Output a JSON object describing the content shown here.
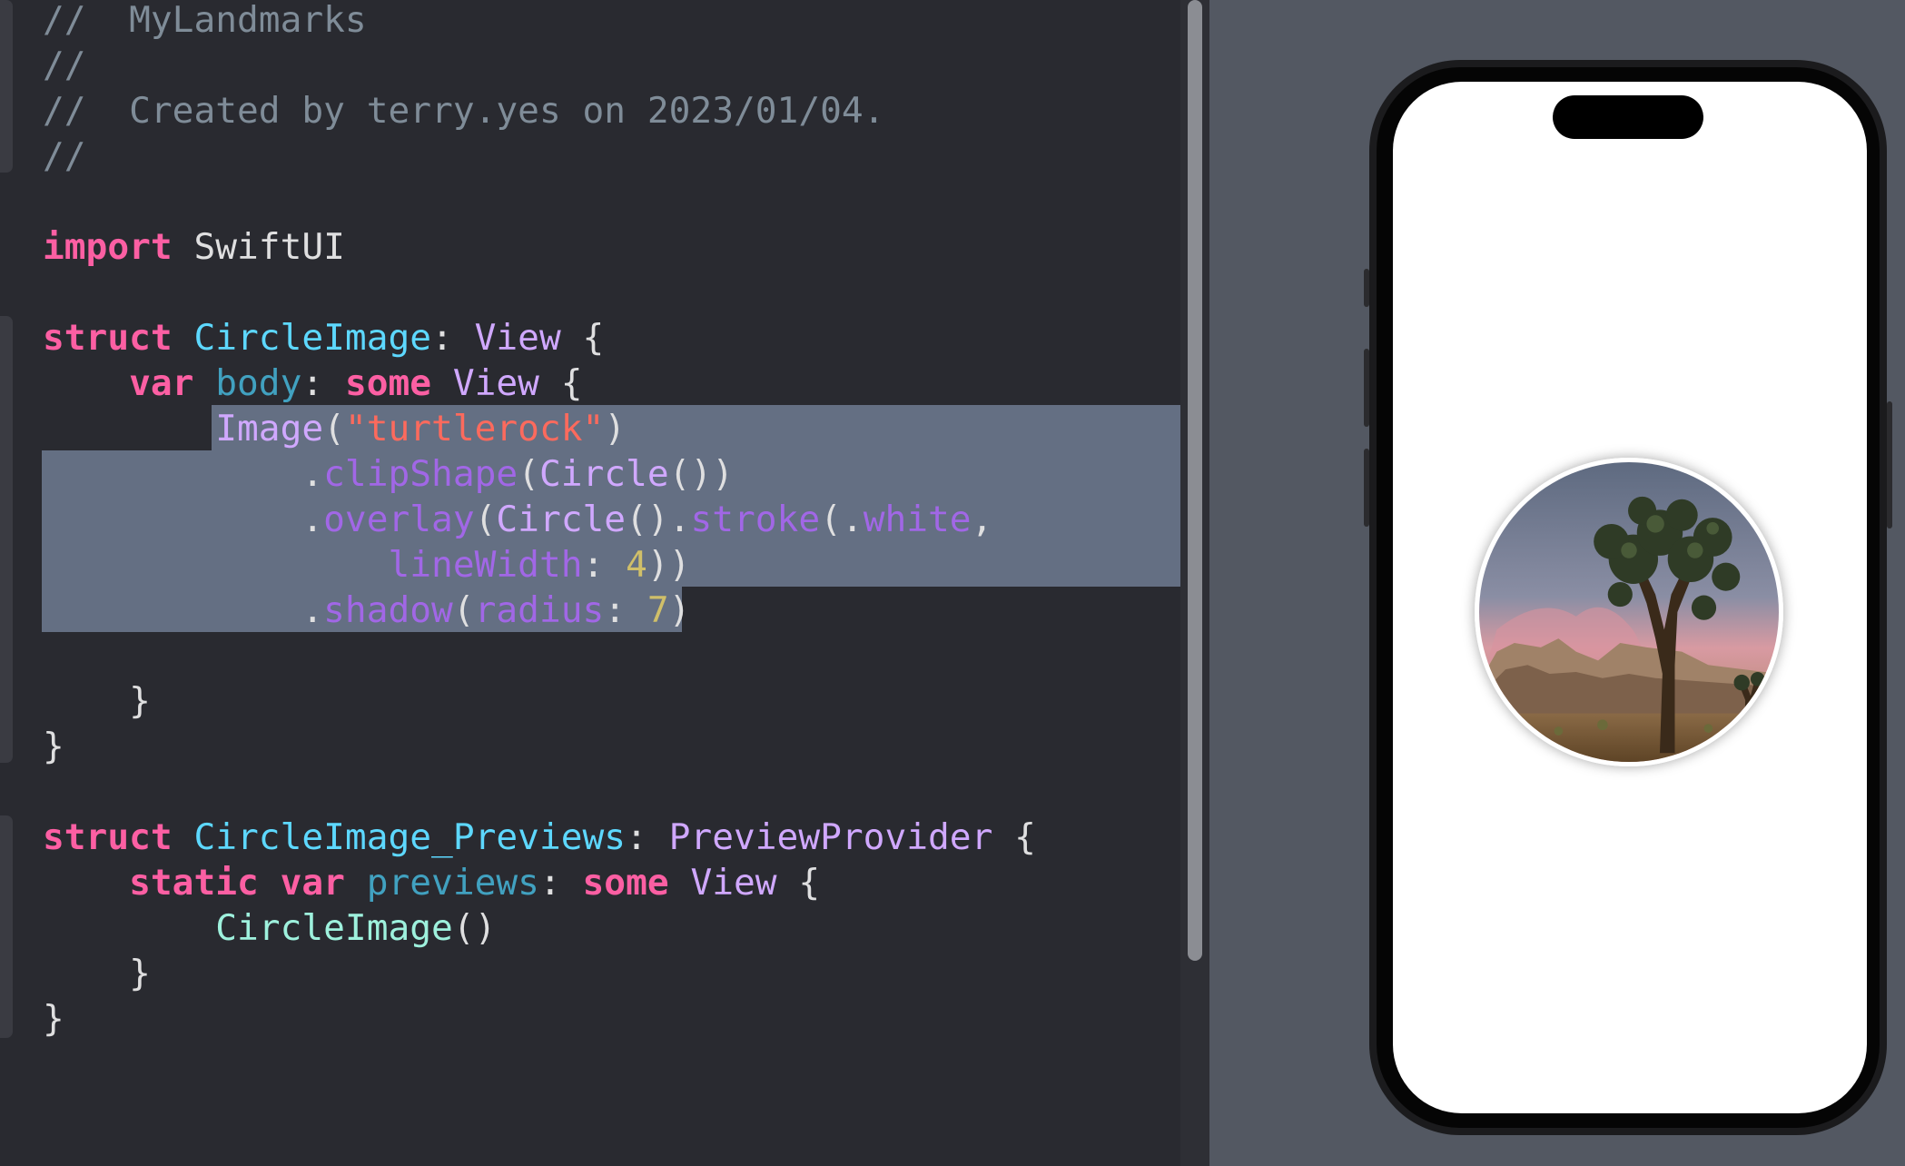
{
  "editor": {
    "lines": [
      {
        "segments": [
          {
            "t": "//  MyLandmarks",
            "c": "cm"
          }
        ]
      },
      {
        "segments": [
          {
            "t": "//",
            "c": "cm"
          }
        ]
      },
      {
        "segments": [
          {
            "t": "//  Created by terry.yes on 2023/01/04.",
            "c": "cm"
          }
        ]
      },
      {
        "segments": [
          {
            "t": "//",
            "c": "cm"
          }
        ]
      },
      {
        "segments": []
      },
      {
        "segments": [
          {
            "t": "import",
            "c": "kw"
          },
          {
            "t": " SwiftUI",
            "c": "pl"
          }
        ]
      },
      {
        "segments": []
      },
      {
        "segments": [
          {
            "t": "struct",
            "c": "kw"
          },
          {
            "t": " ",
            "c": "pl"
          },
          {
            "t": "CircleImage",
            "c": "tn"
          },
          {
            "t": ": ",
            "c": "pl"
          },
          {
            "t": "View",
            "c": "ty"
          },
          {
            "t": " {",
            "c": "pl"
          }
        ]
      },
      {
        "segments": [
          {
            "t": "    ",
            "c": "pl"
          },
          {
            "t": "var",
            "c": "kw"
          },
          {
            "t": " ",
            "c": "pl"
          },
          {
            "t": "body",
            "c": "prop"
          },
          {
            "t": ": ",
            "c": "pl"
          },
          {
            "t": "some",
            "c": "kw"
          },
          {
            "t": " ",
            "c": "pl"
          },
          {
            "t": "View",
            "c": "ty"
          },
          {
            "t": " {",
            "c": "pl"
          }
        ]
      },
      {
        "segments": [
          {
            "t": "        ",
            "c": "pl"
          },
          {
            "t": "Image",
            "c": "ty"
          },
          {
            "t": "(",
            "c": "pl"
          },
          {
            "t": "\"turtlerock\"",
            "c": "str"
          },
          {
            "t": ")",
            "c": "pl"
          }
        ]
      },
      {
        "segments": [
          {
            "t": "            .",
            "c": "pl"
          },
          {
            "t": "clipShape",
            "c": "meth"
          },
          {
            "t": "(",
            "c": "pl"
          },
          {
            "t": "Circle",
            "c": "ty"
          },
          {
            "t": "())",
            "c": "pl"
          }
        ]
      },
      {
        "segments": [
          {
            "t": "            .",
            "c": "pl"
          },
          {
            "t": "overlay",
            "c": "meth"
          },
          {
            "t": "(",
            "c": "pl"
          },
          {
            "t": "Circle",
            "c": "ty"
          },
          {
            "t": "().",
            "c": "pl"
          },
          {
            "t": "stroke",
            "c": "meth"
          },
          {
            "t": "(.",
            "c": "pl"
          },
          {
            "t": "white",
            "c": "meth"
          },
          {
            "t": ",",
            "c": "pl"
          }
        ]
      },
      {
        "segments": [
          {
            "t": "                ",
            "c": "pl"
          },
          {
            "t": "lineWidth",
            "c": "meth"
          },
          {
            "t": ": ",
            "c": "pl"
          },
          {
            "t": "4",
            "c": "num"
          },
          {
            "t": "))",
            "c": "pl"
          }
        ]
      },
      {
        "segments": [
          {
            "t": "            .",
            "c": "pl"
          },
          {
            "t": "shadow",
            "c": "meth"
          },
          {
            "t": "(",
            "c": "pl"
          },
          {
            "t": "radius",
            "c": "meth"
          },
          {
            "t": ": ",
            "c": "pl"
          },
          {
            "t": "7",
            "c": "num"
          },
          {
            "t": ")",
            "c": "pl"
          }
        ]
      },
      {
        "segments": []
      },
      {
        "segments": [
          {
            "t": "    }",
            "c": "pl"
          }
        ]
      },
      {
        "segments": [
          {
            "t": "}",
            "c": "pl"
          }
        ]
      },
      {
        "segments": []
      },
      {
        "segments": [
          {
            "t": "struct",
            "c": "kw"
          },
          {
            "t": " ",
            "c": "pl"
          },
          {
            "t": "CircleImage_Previews",
            "c": "tn"
          },
          {
            "t": ": ",
            "c": "pl"
          },
          {
            "t": "PreviewProvider",
            "c": "ty"
          },
          {
            "t": " {",
            "c": "pl"
          }
        ]
      },
      {
        "segments": [
          {
            "t": "    ",
            "c": "pl"
          },
          {
            "t": "static",
            "c": "kw"
          },
          {
            "t": " ",
            "c": "pl"
          },
          {
            "t": "var",
            "c": "kw"
          },
          {
            "t": " ",
            "c": "pl"
          },
          {
            "t": "previews",
            "c": "prop"
          },
          {
            "t": ": ",
            "c": "pl"
          },
          {
            "t": "some",
            "c": "kw"
          },
          {
            "t": " ",
            "c": "pl"
          },
          {
            "t": "View",
            "c": "ty"
          },
          {
            "t": " {",
            "c": "pl"
          }
        ]
      },
      {
        "segments": [
          {
            "t": "        ",
            "c": "pl"
          },
          {
            "t": "CircleImage",
            "c": "cl"
          },
          {
            "t": "()",
            "c": "pl"
          }
        ]
      },
      {
        "segments": [
          {
            "t": "    }",
            "c": "pl"
          }
        ]
      },
      {
        "segments": [
          {
            "t": "}",
            "c": "pl"
          }
        ]
      }
    ]
  },
  "preview": {
    "device": "iPhone",
    "image_name": "turtlerock"
  },
  "colors": {
    "editor_bg": "#292a30",
    "selection": "#646f83",
    "keyword": "#fc5fa3",
    "type_decl": "#5dd8ff",
    "type": "#d0a8ff",
    "string": "#fc6a5d",
    "number": "#d0bf69",
    "comment": "#7f8c98",
    "canvas_bg": "#535862"
  }
}
